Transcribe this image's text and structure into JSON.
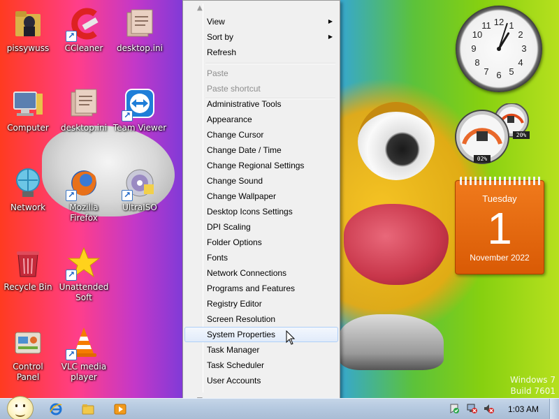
{
  "desktop": {
    "icons": [
      {
        "label": "pissywuss",
        "icon": "folder-figure-icon"
      },
      {
        "label": "CCleaner",
        "icon": "ccleaner-icon"
      },
      {
        "label": "desktop.ini",
        "icon": "ini-file-icon"
      },
      {
        "label": "Computer",
        "icon": "computer-icon"
      },
      {
        "label": "desktop.ini",
        "icon": "ini-file-icon"
      },
      {
        "label": "Team Viewer",
        "icon": "teamviewer-icon"
      },
      {
        "label": "Network",
        "icon": "network-icon"
      },
      {
        "label": "Mozilla Firefox",
        "icon": "firefox-icon"
      },
      {
        "label": "UltraISO",
        "icon": "ultraiso-icon"
      },
      {
        "label": "Recycle Bin",
        "icon": "recycle-bin-icon"
      },
      {
        "label": "Unattended Soft",
        "icon": "star-icon"
      },
      {
        "label": "Control Panel",
        "icon": "control-panel-icon"
      },
      {
        "label": "VLC media player",
        "icon": "vlc-icon"
      }
    ],
    "watermark": {
      "line1": "Windows 7",
      "line2": "Build 7601"
    }
  },
  "context_menu": {
    "items": [
      {
        "label": "View",
        "submenu": true,
        "disabled": false
      },
      {
        "label": "Sort by",
        "submenu": true,
        "disabled": false
      },
      {
        "label": "Refresh",
        "submenu": false,
        "disabled": false
      },
      {
        "label": "Paste",
        "submenu": false,
        "disabled": true
      },
      {
        "label": "Paste shortcut",
        "submenu": false,
        "disabled": true
      },
      {
        "label": "Administrative Tools",
        "submenu": false,
        "disabled": false
      },
      {
        "label": "Appearance",
        "submenu": false,
        "disabled": false
      },
      {
        "label": "Change Cursor",
        "submenu": false,
        "disabled": false
      },
      {
        "label": "Change Date / Time",
        "submenu": false,
        "disabled": false
      },
      {
        "label": "Change Regional Settings",
        "submenu": false,
        "disabled": false
      },
      {
        "label": "Change Sound",
        "submenu": false,
        "disabled": false
      },
      {
        "label": "Change Wallpaper",
        "submenu": false,
        "disabled": false
      },
      {
        "label": "Desktop Icons Settings",
        "submenu": false,
        "disabled": false
      },
      {
        "label": "DPI Scaling",
        "submenu": false,
        "disabled": false
      },
      {
        "label": "Folder Options",
        "submenu": false,
        "disabled": false
      },
      {
        "label": "Fonts",
        "submenu": false,
        "disabled": false
      },
      {
        "label": "Network Connections",
        "submenu": false,
        "disabled": false
      },
      {
        "label": "Programs and Features",
        "submenu": false,
        "disabled": false
      },
      {
        "label": "Registry Editor",
        "submenu": false,
        "disabled": false
      },
      {
        "label": "Screen Resolution",
        "submenu": false,
        "disabled": false
      },
      {
        "label": "System Properties",
        "submenu": false,
        "disabled": false,
        "hovered": true
      },
      {
        "label": "Task Manager",
        "submenu": false,
        "disabled": false
      },
      {
        "label": "Task Scheduler",
        "submenu": false,
        "disabled": false
      },
      {
        "label": "User Accounts",
        "submenu": false,
        "disabled": false
      }
    ],
    "scroll_up_glyph": "▲",
    "scroll_down_glyph": "▼",
    "submenu_glyph": "▶"
  },
  "gadgets": {
    "clock": {
      "hour": 1,
      "minute": 3
    },
    "cpu_meter": {
      "cpu_label": "02%",
      "memory_label": "20%"
    },
    "calendar": {
      "weekday": "Tuesday",
      "day": "1",
      "month_year": "November 2022"
    }
  },
  "taskbar": {
    "pinned": [
      "internet-explorer-icon",
      "windows-explorer-icon",
      "media-player-icon"
    ],
    "tray": [
      "action-center-icon",
      "network-tray-icon",
      "volume-muted-icon"
    ],
    "time": "1:03 AM"
  },
  "colors": {
    "menu_bg": "#f0f0f0",
    "menu_hover": "#e1ebfa",
    "calendar_orange": "#e8650e",
    "taskbar": "#b4c8df"
  }
}
